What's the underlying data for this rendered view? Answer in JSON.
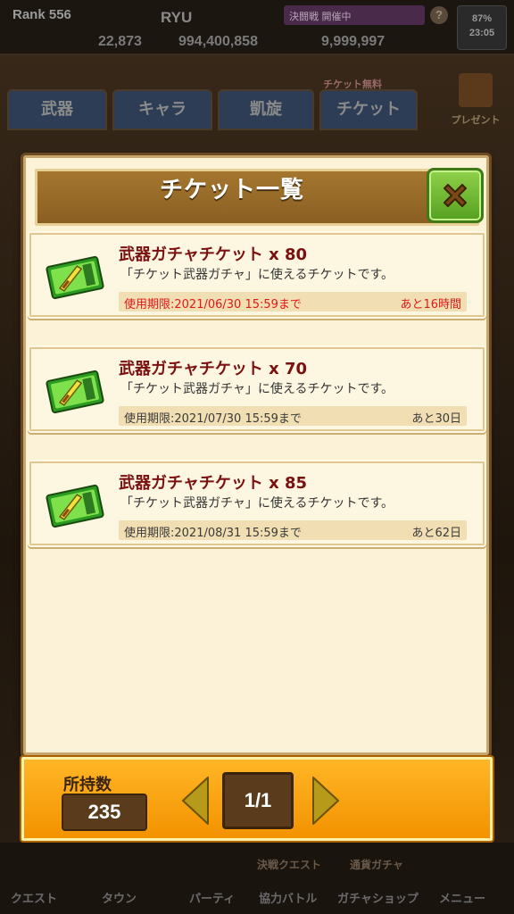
{
  "background": {
    "rank": "Rank 556",
    "player_name": "RYU",
    "event_banner": "決闘戦 開催中",
    "help": "?",
    "battery": "87%",
    "clock": "23:05",
    "currency": [
      "22,873",
      "994,400,858",
      "9,999,997"
    ],
    "tabs": [
      "武器",
      "キャラ",
      "凱旋",
      "チケット"
    ],
    "ticket_fee": "チケット無料",
    "present_label": "プレゼント",
    "nav_items": [
      "クエスト",
      "タウン",
      "パーティ",
      "協力バトル",
      "ガチャショップ",
      "メニュー"
    ],
    "nav_subs": [
      "決戦クエスト",
      "通貨ガチャ"
    ]
  },
  "modal": {
    "title": "チケット一覧",
    "close_icon": "close-icon",
    "tickets": [
      {
        "name": "武器ガチャチケット x 80",
        "description": "「チケット武器ガチャ」に使えるチケットです。",
        "expiry": "使用期限:2021/06/30 15:59まで",
        "remaining": "あと16時間",
        "urgent": true
      },
      {
        "name": "武器ガチャチケット x 70",
        "description": "「チケット武器ガチャ」に使えるチケットです。",
        "expiry": "使用期限:2021/07/30 15:59まで",
        "remaining": "あと30日",
        "urgent": false
      },
      {
        "name": "武器ガチャチケット x 85",
        "description": "「チケット武器ガチャ」に使えるチケットです。",
        "expiry": "使用期限:2021/08/31 15:59まで",
        "remaining": "あと62日",
        "urgent": false
      }
    ]
  },
  "footer": {
    "owned_label": "所持数",
    "owned_count": "235",
    "page": "1/1"
  },
  "colors": {
    "modal_bg": "#fbf2d8",
    "header_brown": "#a4762f",
    "close_green": "#6cbf2f",
    "urgent_red": "#e01818",
    "footer_orange": "#f8a515"
  }
}
